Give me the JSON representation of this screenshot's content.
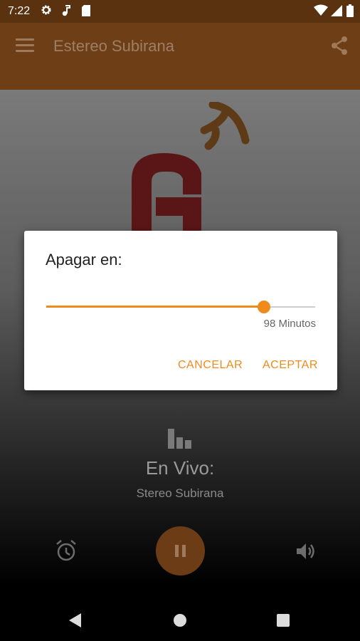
{
  "status_bar": {
    "time": "7:22",
    "left_icons": [
      "gear-icon",
      "music-note-icon",
      "sd-card-icon"
    ],
    "right_icons": [
      "wifi-icon",
      "signal-icon",
      "battery-icon"
    ]
  },
  "app_bar": {
    "title": "Estereo Subirana",
    "menu_icon": "hamburger-menu-icon",
    "share_icon": "share-icon",
    "color": "#6e3f17"
  },
  "dialog": {
    "title": "Apagar en:",
    "slider_fraction": 0.81,
    "value_label": "98 Minutos",
    "cancel_label": "CANCELAR",
    "accept_label": "ACEPTAR",
    "accent_color": "#ef8a1d"
  },
  "player": {
    "live_label": "En Vivo:",
    "station_name": "Stereo Subirana",
    "state": "playing"
  },
  "nav": {
    "icons": [
      "back-icon",
      "home-icon",
      "recents-icon"
    ]
  }
}
